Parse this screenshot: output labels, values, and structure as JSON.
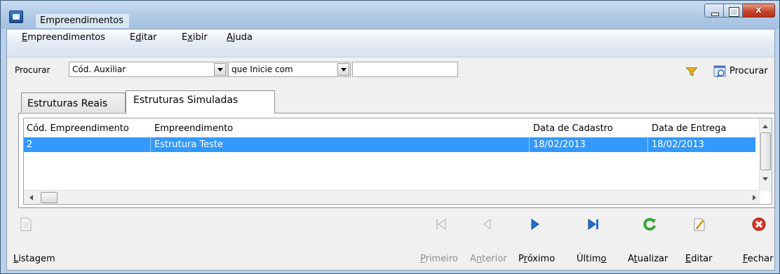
{
  "window": {
    "title": "Empreendimentos",
    "close_glyph": "x"
  },
  "menu": [
    {
      "label": "Empreendimentos",
      "accel": "E",
      "rest": "mpreendimentos"
    },
    {
      "label": "Editar",
      "pre": "E",
      "accel": "d",
      "rest": "itar"
    },
    {
      "label": "Exibir",
      "pre": "E",
      "accel": "x",
      "rest": "ibir"
    },
    {
      "label": "Ajuda",
      "accel": "A",
      "rest": "juda"
    }
  ],
  "search": {
    "label": "Procurar",
    "field_value": "Cód. Auxiliar",
    "mode_value": "que Inicie com",
    "text_value": "",
    "button_label": "Procurar"
  },
  "tabs": [
    {
      "label": "Estruturas Reais",
      "active": false
    },
    {
      "label": "Estruturas Simuladas",
      "active": true
    }
  ],
  "grid": {
    "columns": [
      "Cód. Empreendimento",
      "Empreendimento",
      "Data de Cadastro",
      "Data de Entrega"
    ],
    "rows": [
      [
        "2",
        "Estrutura Teste",
        "18/02/2013",
        "18/02/2013"
      ]
    ],
    "selected_row": 0
  },
  "toolbar": {
    "listagem": {
      "label": "Listagem",
      "accel": "L",
      "rest": "istagem"
    },
    "primeiro": {
      "label": "Primeiro",
      "accel": "P",
      "rest": "rimeiro"
    },
    "anterior": {
      "label": "Anterior",
      "pre": "A",
      "accel": "n",
      "rest": "terior"
    },
    "proximo": {
      "label": "Próximo",
      "pre": "P",
      "accel": "r",
      "rest": "óximo"
    },
    "ultimo": {
      "label": "Último",
      "pre": "Últim",
      "accel": "o",
      "rest": ""
    },
    "atualizar": {
      "label": "Atualizar",
      "pre": "A",
      "accel": "t",
      "rest": "ualizar"
    },
    "editar": {
      "label": "Editar",
      "accel": "E",
      "rest": "ditar"
    },
    "fechar": {
      "label": "Fechar",
      "accel": "F",
      "rest": "echar"
    }
  },
  "colors": {
    "selection": "#3399ff",
    "nav_blue": "#1e6fd6",
    "refresh_green": "#3aa53a",
    "close_red": "#d8362a",
    "filter_yellow": "#e8b21f"
  }
}
